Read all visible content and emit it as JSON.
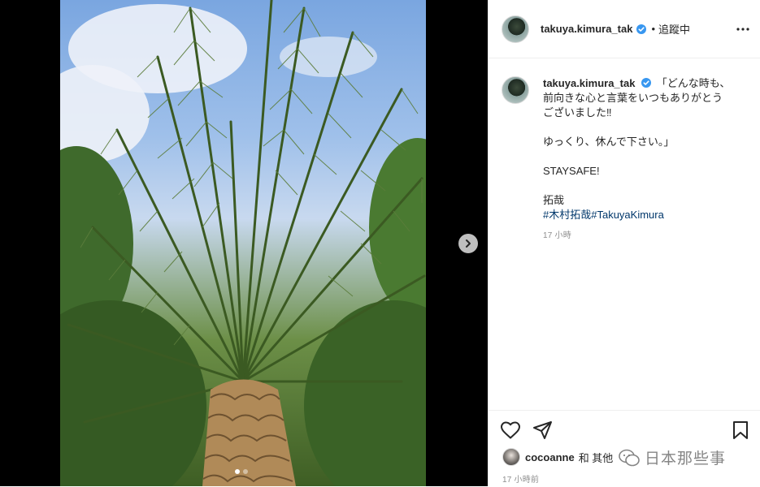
{
  "post": {
    "image_alt": "palm tree",
    "carousel": {
      "total": 2,
      "active": 1
    }
  },
  "header": {
    "username": "takuya.kimura_tak",
    "separator": "•",
    "follow_label": "追蹤中"
  },
  "caption": {
    "username": "takuya.kimura_tak",
    "line1": "「どんな時も、",
    "line2": "前向きな心と言葉をいつもありがとう",
    "line3": "ございました‼",
    "line4": "ゆっくり、休んで下さい。」",
    "line5": "STAYSAFE!",
    "line6": "拓哉",
    "hashtag1": "#木村拓哉",
    "hashtag2": "#TakuyaKimura",
    "time": "17 小時"
  },
  "footer": {
    "liked_by": "cocoanne",
    "liked_rest": "和 其他",
    "posted_time": "17 小時前",
    "watermark": "日本那些事"
  },
  "colors": {
    "link": "#00376b",
    "verified": "#3897f0",
    "muted": "#8e8e8e",
    "border": "#efefef"
  }
}
